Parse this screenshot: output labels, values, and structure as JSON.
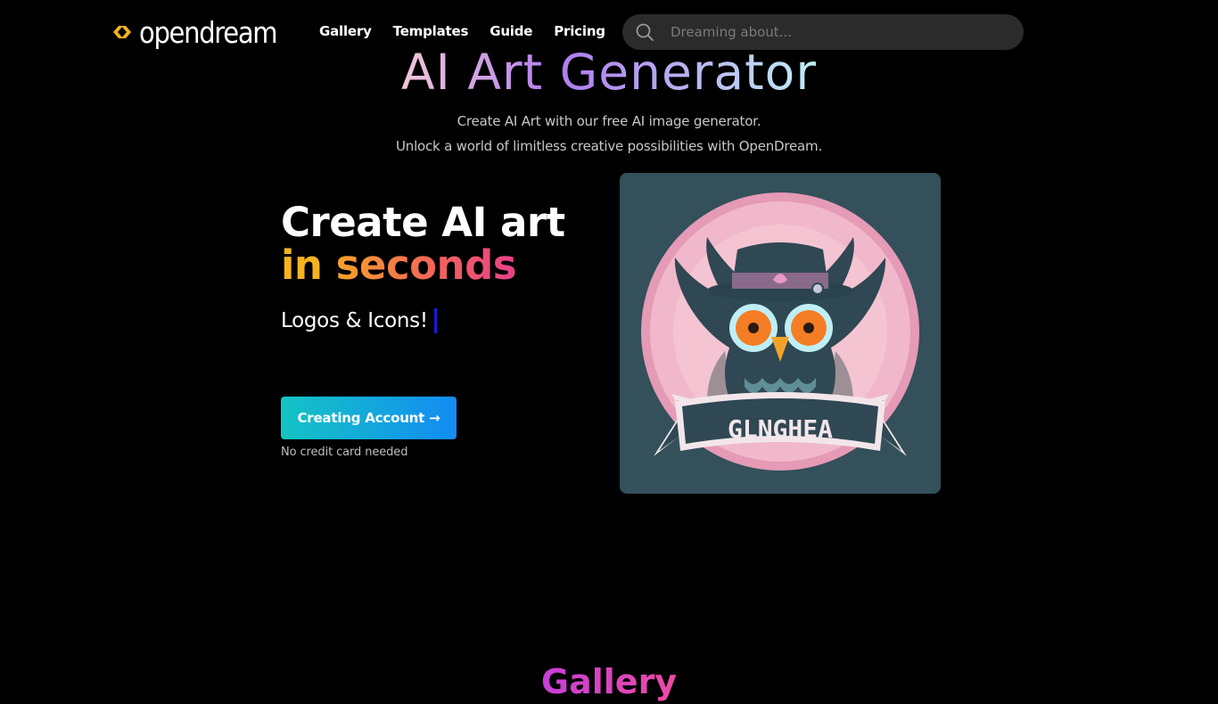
{
  "nav": {
    "logo_text": "opendream",
    "links": [
      {
        "label": "Gallery"
      },
      {
        "label": "Templates"
      },
      {
        "label": "Guide"
      },
      {
        "label": "Pricing"
      }
    ],
    "search": {
      "placeholder": "Dreaming about...",
      "value": ""
    }
  },
  "hero": {
    "title": "AI Art Generator",
    "subtitle_line1": "Create AI Art with our free AI image generator.",
    "subtitle_line2": "Unlock a world of limitless creative possibilities with OpenDream."
  },
  "promo": {
    "headline_line1": "Create AI art",
    "headline_in": "in",
    "headline_seconds": "seconds",
    "typewriter_text": "Logos & Icons!",
    "cta_label": "Creating Account →",
    "cta_note": "No credit card needed"
  },
  "artwork": {
    "banner_text": "GLNGHEA",
    "background_color": "#33505b"
  },
  "gallery": {
    "heading": "Gallery"
  },
  "colors": {
    "accent_logo": "#f5b31f",
    "cta_gradient_start": "#14c4c4",
    "cta_gradient_end": "#138cf2",
    "caret": "#1b18e0"
  }
}
